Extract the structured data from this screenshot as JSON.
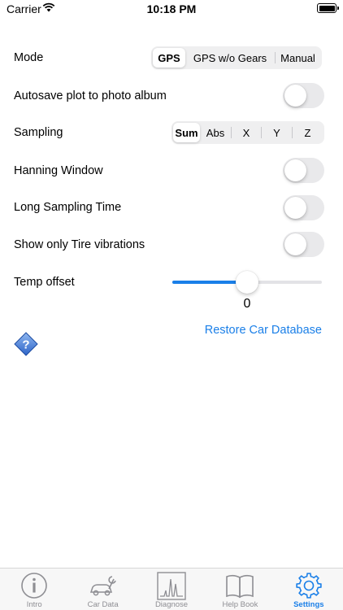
{
  "status_bar": {
    "carrier": "Carrier",
    "time": "10:18 PM"
  },
  "settings": {
    "mode": {
      "label": "Mode",
      "options": [
        "GPS",
        "GPS w/o Gears",
        "Manual"
      ],
      "selected": "GPS"
    },
    "autosave": {
      "label": "Autosave plot to photo album",
      "on": false
    },
    "sampling": {
      "label": "Sampling",
      "options": [
        "Sum",
        "Abs",
        "X",
        "Y",
        "Z"
      ],
      "selected": "Sum"
    },
    "hanning": {
      "label": "Hanning Window",
      "on": false
    },
    "long_sampling": {
      "label": "Long Sampling Time",
      "on": false
    },
    "tire_vibrations": {
      "label": "Show only Tire vibrations",
      "on": false
    },
    "temp_offset": {
      "label": "Temp offset",
      "value": "0",
      "slider_fraction": 0.5
    },
    "restore_label": "Restore Car Database"
  },
  "tabs": [
    {
      "label": "Intro",
      "icon": "info-icon"
    },
    {
      "label": "Car Data",
      "icon": "car-wrench-icon"
    },
    {
      "label": "Diagnose",
      "icon": "spectrum-icon"
    },
    {
      "label": "Help Book",
      "icon": "book-icon"
    },
    {
      "label": "Settings",
      "icon": "gear-icon",
      "active": true
    }
  ],
  "colors": {
    "accent": "#1a7fe8",
    "inactive": "#8e8e93"
  }
}
